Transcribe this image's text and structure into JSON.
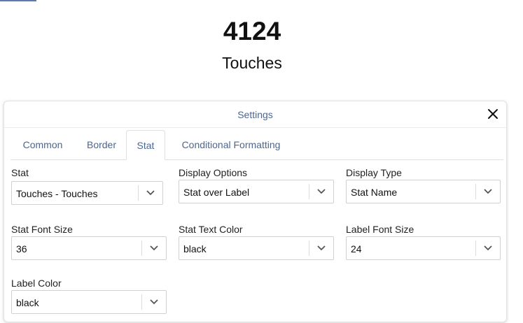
{
  "stat": {
    "value": "4124",
    "label": "Touches"
  },
  "panel": {
    "title": "Settings",
    "close_icon": "close-icon"
  },
  "tabs": [
    {
      "label": "Common"
    },
    {
      "label": "Border"
    },
    {
      "label": "Stat",
      "active": true
    },
    {
      "label": "Conditional Formatting"
    }
  ],
  "fields": {
    "stat": {
      "label": "Stat",
      "value": "Touches - Touches"
    },
    "display_options": {
      "label": "Display Options",
      "value": "Stat over Label"
    },
    "display_type": {
      "label": "Display Type",
      "value": "Stat Name"
    },
    "stat_font_size": {
      "label": "Stat Font Size",
      "value": "36"
    },
    "stat_text_color": {
      "label": "Stat Text Color",
      "value": "black"
    },
    "label_font_size": {
      "label": "Label Font Size",
      "value": "24"
    },
    "label_color": {
      "label": "Label Color",
      "value": "black"
    }
  },
  "colors": {
    "accent": "#4a6691",
    "border": "#d0d0d0"
  }
}
